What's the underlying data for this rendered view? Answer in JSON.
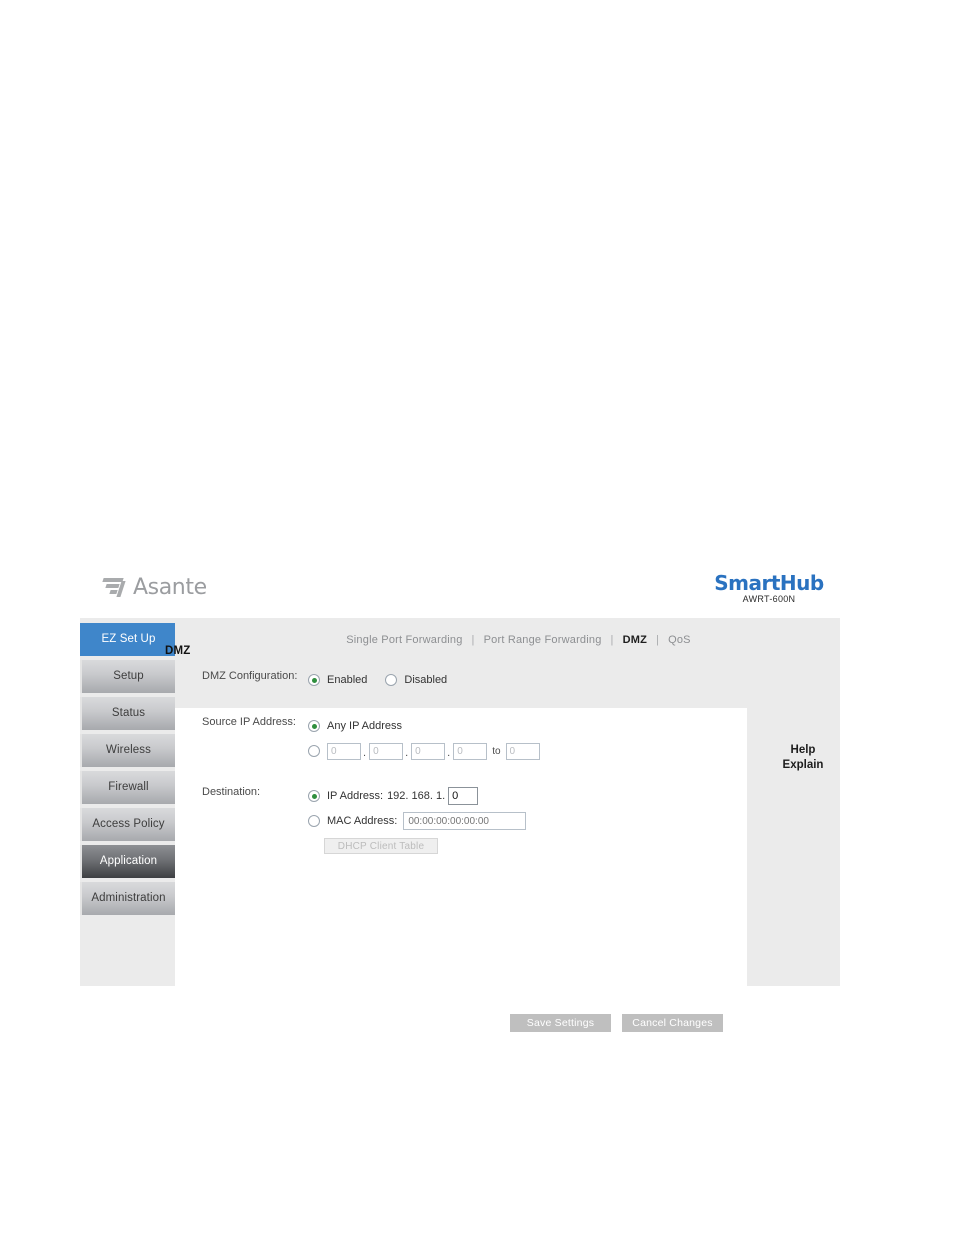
{
  "brand": {
    "logo_text": "Asante",
    "product_name": "SmartHub",
    "model": "AWRT-600N"
  },
  "sidebar": {
    "items": [
      {
        "label": "EZ Set Up",
        "state": "active"
      },
      {
        "label": "Setup",
        "state": "normal"
      },
      {
        "label": "Status",
        "state": "normal"
      },
      {
        "label": "Wireless",
        "state": "normal"
      },
      {
        "label": "Firewall",
        "state": "normal"
      },
      {
        "label": "Access Policy",
        "state": "normal"
      },
      {
        "label": "Application",
        "state": "hovered"
      },
      {
        "label": "Administration",
        "state": "normal"
      }
    ]
  },
  "tabs": {
    "separator": "|",
    "items": [
      {
        "label": "Single Port Forwarding",
        "current": false
      },
      {
        "label": "Port Range Forwarding",
        "current": false
      },
      {
        "label": "DMZ",
        "current": true
      },
      {
        "label": "QoS",
        "current": false
      }
    ]
  },
  "main": {
    "section_title": "DMZ",
    "dmz_configuration": {
      "label": "DMZ Configuration:",
      "options": [
        {
          "label": "Enabled",
          "selected": true
        },
        {
          "label": "Disabled",
          "selected": false
        }
      ]
    },
    "source_ip": {
      "label": "Source IP Address:",
      "any_option": {
        "label": "Any IP Address",
        "selected": true
      },
      "range_option": {
        "selected": false
      },
      "octets": [
        "0",
        "0",
        "0",
        "0"
      ],
      "octet_separator": ".",
      "to_label": "to",
      "range_end": "0"
    },
    "destination": {
      "label": "Destination:",
      "ip_option": {
        "label": "IP Address:",
        "prefix": "192. 168. 1.",
        "value": "0",
        "selected": true
      },
      "mac_option": {
        "label": "MAC Address:",
        "placeholder": "00:00:00:00:00:00",
        "value": "",
        "selected": false
      },
      "dhcp_button": "DHCP Client Table"
    }
  },
  "help": {
    "line1": "Help",
    "line2": "Explain"
  },
  "footer": {
    "save_label": "Save Settings",
    "cancel_label": "Cancel Changes"
  },
  "colors": {
    "accent_blue": "#3f86ca",
    "brand_blue": "#2a72c0",
    "radio_green": "#2f8f3e",
    "panel_grey": "#ebebeb",
    "button_grey": "#bfbfbf"
  }
}
